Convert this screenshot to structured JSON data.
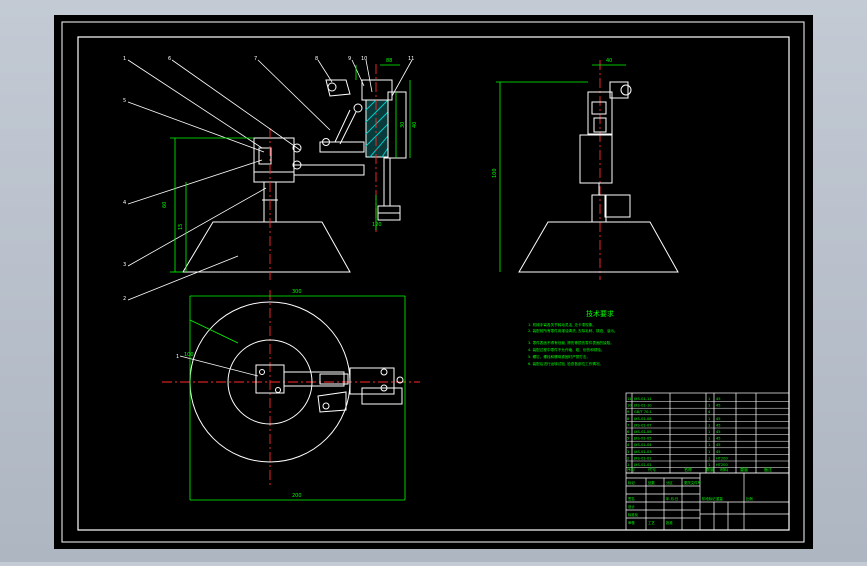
{
  "colors": {
    "background": "#000000",
    "frame": "#ffffff",
    "geometry": "#ffffff",
    "centerline": "#ff2a2a",
    "dimension": "#00ff00",
    "hatch": "#00c8c8",
    "text": "#00ff00"
  },
  "balloons": {
    "side_view": [
      "1",
      "6",
      "7",
      "8",
      "9",
      "10",
      "11",
      "5",
      "4",
      "3",
      "2",
      "1"
    ]
  },
  "dimensions": {
    "front_view": [
      "60",
      "15",
      "30",
      "40",
      "88",
      "120"
    ],
    "right_view": [
      "100",
      "40"
    ],
    "top_view": [
      "300",
      "200",
      "100"
    ]
  },
  "notes": {
    "heading": "技术要求",
    "lines": [
      "1. 机械手臂各关节转动灵活, 无卡滞现象。",
      "2. 装配前所有零件用煤油清洗, 去除毛刺、锈迹、油污。",
      "3. 零件表面不得有划痕, 擦伤等损伤零件表面的缺陷。",
      "4. 装配过程中零件不允许磕、碰、划伤和锈蚀。",
      "5. 螺钉、螺栓和螺母紧固时严禁打击。",
      "6. 装配后进行运转试验, 检查各部位工作情况。"
    ]
  },
  "title_block": {
    "parts": [
      {
        "no": "11",
        "code": "JXS-01-11",
        "name": "",
        "qty": "1",
        "mat": "45"
      },
      {
        "no": "10",
        "code": "JXS-01-10",
        "name": "",
        "qty": "1",
        "mat": "45"
      },
      {
        "no": "9",
        "code": "GB/T 70.1",
        "name": "",
        "qty": "4",
        "mat": ""
      },
      {
        "no": "8",
        "code": "JXS-01-08",
        "name": "",
        "qty": "1",
        "mat": "45"
      },
      {
        "no": "7",
        "code": "JXS-01-07",
        "name": "",
        "qty": "1",
        "mat": "45"
      },
      {
        "no": "6",
        "code": "JXS-01-06",
        "name": "",
        "qty": "1",
        "mat": "45"
      },
      {
        "no": "5",
        "code": "JXS-01-05",
        "name": "",
        "qty": "1",
        "mat": "45"
      },
      {
        "no": "4",
        "code": "JXS-01-04",
        "name": "",
        "qty": "1",
        "mat": "45"
      },
      {
        "no": "3",
        "code": "JXS-01-03",
        "name": "",
        "qty": "1",
        "mat": "45"
      },
      {
        "no": "2",
        "code": "JXS-01-02",
        "name": "",
        "qty": "1",
        "mat": "HT200"
      },
      {
        "no": "1",
        "code": "JXS-01-01",
        "name": "",
        "qty": "1",
        "mat": "HT200"
      }
    ],
    "header": {
      "no": "序号",
      "code": "代号",
      "name": "名称",
      "qty": "数量",
      "mat": "材料",
      "weight": "重量",
      "note": "备注"
    },
    "misc": [
      "标记",
      "处数",
      "分区",
      "更改文件号",
      "签名",
      "年.月.日",
      "设计",
      "标准化",
      "阶段标记",
      "重量",
      "比例",
      "审核",
      "工艺",
      "批准"
    ]
  }
}
